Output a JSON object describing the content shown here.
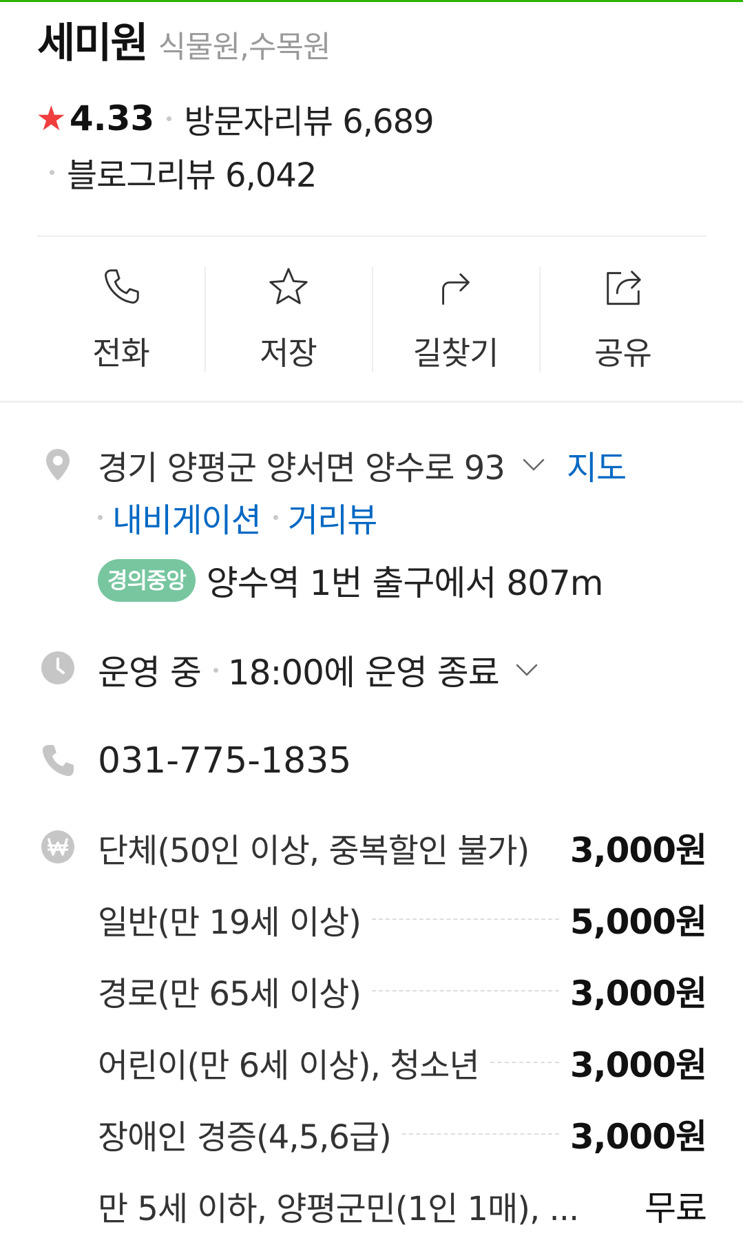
{
  "place": {
    "name": "세미원",
    "category": "식물원,수목원"
  },
  "rating": {
    "score": "4.33",
    "visitor_reviews_label": "방문자리뷰 6,689",
    "blog_reviews_label": "블로그리뷰 6,042"
  },
  "actions": [
    {
      "label": "전화",
      "icon": "phone-icon"
    },
    {
      "label": "저장",
      "icon": "star-outline-icon"
    },
    {
      "label": "길찾기",
      "icon": "directions-icon"
    },
    {
      "label": "공유",
      "icon": "share-icon"
    }
  ],
  "address": {
    "text": "경기 양평군 양서면 양수로 93",
    "map_link": "지도",
    "navigation_link": "내비게이션",
    "streetview_link": "거리뷰",
    "subway_line": "경의중앙",
    "subway_text": "양수역 1번 출구에서 807m"
  },
  "hours": {
    "status": "운영 중",
    "detail": "18:00에 운영 종료"
  },
  "phone": "031-775-1835",
  "prices": [
    {
      "label": "단체(50인 이상, 중복할인 불가)",
      "value": "3,000원"
    },
    {
      "label": "일반(만 19세 이상)",
      "value": "5,000원"
    },
    {
      "label": "경로(만 65세 이상)",
      "value": "3,000원"
    },
    {
      "label": "어린이(만 6세 이상), 청소년",
      "value": "3,000원"
    },
    {
      "label": "장애인 경증(4,5,6급)",
      "value": "3,000원"
    },
    {
      "label": "만 5세 이하, 양평군민(1인 1매), ...",
      "value": "무료"
    }
  ],
  "colors": {
    "accent_green": "#2db400",
    "star_red": "#f03e3e",
    "link_blue": "#0068c3",
    "subway_badge": "#77c6a0"
  }
}
